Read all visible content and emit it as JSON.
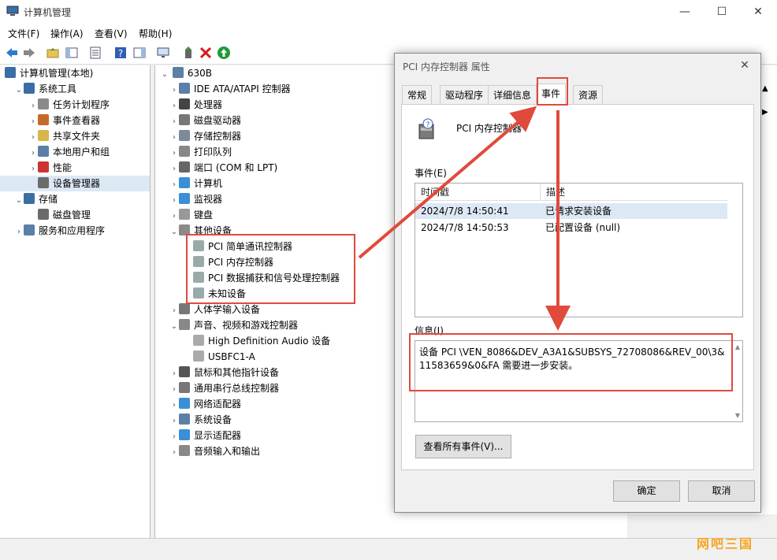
{
  "window": {
    "title": "计算机管理",
    "controls": [
      "—",
      "☐",
      "✕"
    ]
  },
  "menu": [
    "文件(F)",
    "操作(A)",
    "查看(V)",
    "帮助(H)"
  ],
  "left_tree": {
    "root": "计算机管理(本地)",
    "items": [
      {
        "label": "系统工具",
        "level": 1,
        "expander": "⌄"
      },
      {
        "label": "任务计划程序",
        "level": 2,
        "expander": "›"
      },
      {
        "label": "事件查看器",
        "level": 2,
        "expander": "›"
      },
      {
        "label": "共享文件夹",
        "level": 2,
        "expander": "›"
      },
      {
        "label": "本地用户和组",
        "level": 2,
        "expander": "›"
      },
      {
        "label": "性能",
        "level": 2,
        "expander": "›"
      },
      {
        "label": "设备管理器",
        "level": 2,
        "expander": ""
      },
      {
        "label": "存储",
        "level": 1,
        "expander": "⌄"
      },
      {
        "label": "磁盘管理",
        "level": 2,
        "expander": ""
      },
      {
        "label": "服务和应用程序",
        "level": 1,
        "expander": "›"
      }
    ]
  },
  "device_tree": {
    "root": "630B",
    "items": [
      {
        "label": "IDE ATA/ATAPI 控制器",
        "level": 1,
        "expander": "›"
      },
      {
        "label": "处理器",
        "level": 1,
        "expander": "›"
      },
      {
        "label": "磁盘驱动器",
        "level": 1,
        "expander": "›"
      },
      {
        "label": "存储控制器",
        "level": 1,
        "expander": "›"
      },
      {
        "label": "打印队列",
        "level": 1,
        "expander": "›"
      },
      {
        "label": "端口 (COM 和 LPT)",
        "level": 1,
        "expander": "›"
      },
      {
        "label": "计算机",
        "level": 1,
        "expander": "›"
      },
      {
        "label": "监视器",
        "level": 1,
        "expander": "›"
      },
      {
        "label": "键盘",
        "level": 1,
        "expander": "›"
      },
      {
        "label": "其他设备",
        "level": 1,
        "expander": "⌄"
      },
      {
        "label": "PCI 简单通讯控制器",
        "level": 2,
        "expander": ""
      },
      {
        "label": "PCI 内存控制器",
        "level": 2,
        "expander": ""
      },
      {
        "label": "PCI 数据捕获和信号处理控制器",
        "level": 2,
        "expander": ""
      },
      {
        "label": "未知设备",
        "level": 2,
        "expander": ""
      },
      {
        "label": "人体学输入设备",
        "level": 1,
        "expander": "›"
      },
      {
        "label": "声音、视频和游戏控制器",
        "level": 1,
        "expander": "⌄"
      },
      {
        "label": "High Definition Audio 设备",
        "level": 2,
        "expander": ""
      },
      {
        "label": "USBFC1-A",
        "level": 2,
        "expander": ""
      },
      {
        "label": "鼠标和其他指针设备",
        "level": 1,
        "expander": "›"
      },
      {
        "label": "通用串行总线控制器",
        "level": 1,
        "expander": "›"
      },
      {
        "label": "网络适配器",
        "level": 1,
        "expander": "›"
      },
      {
        "label": "系统设备",
        "level": 1,
        "expander": "›"
      },
      {
        "label": "显示适配器",
        "level": 1,
        "expander": "›"
      },
      {
        "label": "音频输入和输出",
        "level": 1,
        "expander": "›"
      }
    ]
  },
  "dialog": {
    "title": "PCI 内存控制器 属性",
    "tabs": [
      "常规",
      "驱动程序",
      "详细信息",
      "事件",
      "资源"
    ],
    "active_tab": "事件",
    "device_name": "PCI 内存控制器",
    "events_label": "事件(E)",
    "columns": [
      "时间戳",
      "描述"
    ],
    "events": [
      {
        "time": "2024/7/8 14:50:41",
        "desc": "已请求安装设备"
      },
      {
        "time": "2024/7/8 14:50:53",
        "desc": "已配置设备 (null)"
      }
    ],
    "info_label": "信息(I)",
    "info_text": "设备 PCI \\VEN_8086&DEV_A3A1&SUBSYS_72708086&REV_00\\3&11583659&0&FA 需要进一步安装。",
    "view_all_button": "查看所有事件(V)...",
    "ok_button": "确定",
    "cancel_button": "取消"
  },
  "watermark": "网吧三国",
  "colors": {
    "annotation_red": "#e04a3c",
    "selection": "#dde8f5",
    "watermark": "#f5a623"
  }
}
